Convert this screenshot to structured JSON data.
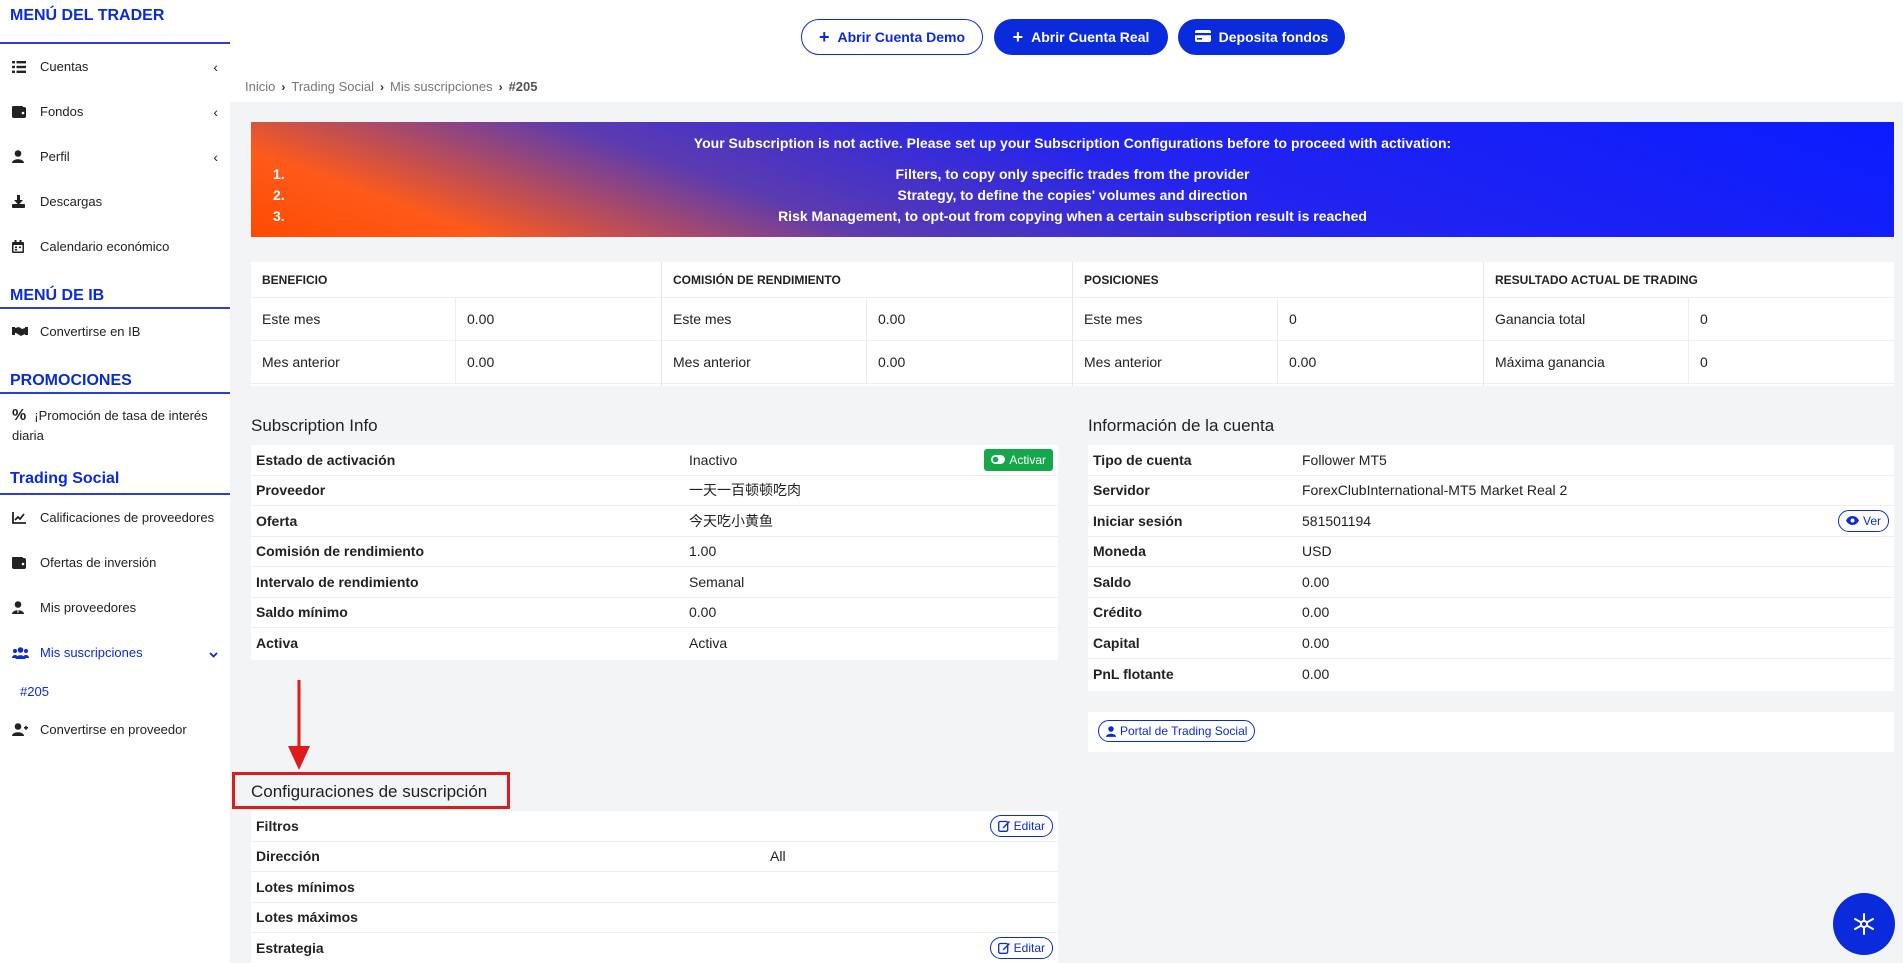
{
  "sidebar": {
    "trader_menu_title": "MENÚ DEL TRADER",
    "trader_items": [
      {
        "label": "Cuentas",
        "icon": "list-icon"
      },
      {
        "label": "Fondos",
        "icon": "wallet-icon"
      },
      {
        "label": "Perfil",
        "icon": "user-icon"
      },
      {
        "label": "Descargas",
        "icon": "download-icon"
      },
      {
        "label": "Calendario económico",
        "icon": "calendar-icon"
      }
    ],
    "ib_menu_title": "MENÚ DE IB",
    "ib_items": [
      {
        "label": "Convertirse en IB",
        "icon": "handshake-icon"
      }
    ],
    "promo_title": "PROMOCIONES",
    "promo_items": [
      {
        "label": "¡Promoción de tasa de interés diaria",
        "icon": "percent-icon"
      }
    ],
    "social_title": "Trading Social",
    "social_items": [
      {
        "label": "Calificaciones de proveedores",
        "icon": "chart-line-icon"
      },
      {
        "label": "Ofertas de inversión",
        "icon": "wallet-icon"
      },
      {
        "label": "Mis proveedores",
        "icon": "user-tie-icon"
      },
      {
        "label": "Mis suscripciones",
        "icon": "users-icon"
      },
      {
        "label": "#205"
      },
      {
        "label": "Convertirse en proveedor",
        "icon": "user-plus-icon"
      }
    ]
  },
  "topbar": {
    "demo_label": "Abrir Cuenta Demo",
    "real_label": "Abrir Cuenta Real",
    "deposit_label": "Deposita fondos"
  },
  "breadcrumb": [
    "Inicio",
    "Trading Social",
    "Mis suscripciones",
    "#205"
  ],
  "banner": {
    "title": "Your Subscription is not active. Please set up your Subscription Configurations before to proceed with activation:",
    "items": [
      {
        "num": "1.",
        "text": "Filters, to copy only specific trades from the provider"
      },
      {
        "num": "2.",
        "text": "Strategy, to define the copies' volumes and direction"
      },
      {
        "num": "3.",
        "text": "Risk Management, to opt-out from copying when a certain subscription result is reached"
      }
    ]
  },
  "stats": [
    {
      "title": "BENEFICIO",
      "rows": [
        {
          "k": "Este mes",
          "v": "0.00"
        },
        {
          "k": "Mes anterior",
          "v": "0.00"
        }
      ]
    },
    {
      "title": "COMISIÓN DE RENDIMIENTO",
      "rows": [
        {
          "k": "Este mes",
          "v": "0.00"
        },
        {
          "k": "Mes anterior",
          "v": "0.00"
        }
      ]
    },
    {
      "title": "POSICIONES",
      "rows": [
        {
          "k": "Este mes",
          "v": "0"
        },
        {
          "k": "Mes anterior",
          "v": "0.00"
        }
      ]
    },
    {
      "title": "RESULTADO ACTUAL DE TRADING",
      "rows": [
        {
          "k": "Ganancia total",
          "v": "0"
        },
        {
          "k": "Máxima ganancia",
          "v": "0"
        }
      ]
    }
  ],
  "subscription_info": {
    "title": "Subscription Info",
    "activate_label": "Activar",
    "rows": [
      {
        "k": "Estado de activación",
        "v": "Inactivo"
      },
      {
        "k": "Proveedor",
        "v": "一天一百顿顿吃肉"
      },
      {
        "k": "Oferta",
        "v": "今天吃小黄鱼"
      },
      {
        "k": "Comisión de rendimiento",
        "v": "1.00"
      },
      {
        "k": "Intervalo de rendimiento",
        "v": "Semanal"
      },
      {
        "k": "Saldo mínimo",
        "v": "0.00"
      },
      {
        "k": "Activa",
        "v": "Activa"
      }
    ]
  },
  "account_info": {
    "title": "Información de la cuenta",
    "view_label": "Ver",
    "rows": [
      {
        "k": "Tipo de cuenta",
        "v": "Follower MT5"
      },
      {
        "k": "Servidor",
        "v": "ForexClubInternational-MT5 Market Real 2"
      },
      {
        "k": "Iniciar sesión",
        "v": "581501194"
      },
      {
        "k": "Moneda",
        "v": "USD"
      },
      {
        "k": "Saldo",
        "v": "0.00"
      },
      {
        "k": "Crédito",
        "v": "0.00"
      },
      {
        "k": "Capital",
        "v": "0.00"
      },
      {
        "k": "PnL flotante",
        "v": "0.00"
      }
    ],
    "portal_label": "Portal de Trading Social"
  },
  "config": {
    "title": "Configuraciones de suscripción",
    "edit_label": "Editar",
    "rows": [
      {
        "k": "Filtros",
        "v": ""
      },
      {
        "k": "Dirección",
        "v": "All"
      },
      {
        "k": "Lotes mínimos",
        "v": ""
      },
      {
        "k": "Lotes máximos",
        "v": ""
      },
      {
        "k": "Estrategia",
        "v": ""
      }
    ]
  },
  "colors": {
    "brand": "#0a2bdb",
    "success": "#15a84b",
    "highlight": "#e01b1b"
  }
}
